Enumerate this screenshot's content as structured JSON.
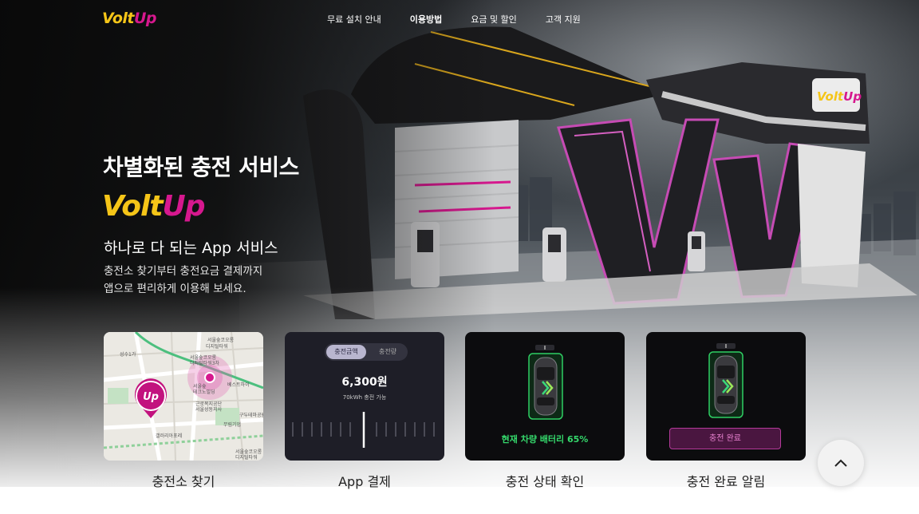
{
  "header": {
    "logo_main": "Volt",
    "logo_accent": "Up",
    "nav": [
      {
        "label": "무료 설치 안내",
        "active": false
      },
      {
        "label": "이용방법",
        "active": true
      },
      {
        "label": "요금 및 할인",
        "active": false
      },
      {
        "label": "고객 지원",
        "active": false
      }
    ]
  },
  "hero": {
    "headline": "차별화된 충전 서비스",
    "brand_main": "Volt",
    "brand_accent": "Up",
    "subtitle": "하나로 다 되는 App 서비스",
    "description_line1": "충전소 찾기부터 충전요금 결제까지",
    "description_line2": "앱으로 편리하게 이용해 보세요.",
    "station_sign": "VoltUp"
  },
  "features": [
    {
      "label": "충전소 찾기"
    },
    {
      "label": "App 결제"
    },
    {
      "label": "충전 상태 확인"
    },
    {
      "label": "충전 완료 알림"
    }
  ],
  "map_card": {
    "pin_logo": "Up",
    "labels": [
      "서울숲코오롱",
      "디지털타워",
      "서울숲코오롱",
      "디지털타워3차",
      "베스트하이",
      "서울숲",
      "테크노빌딩",
      "근로복지공단",
      "서울성동지사",
      "서울숲코오롱",
      "디지털타워",
      "성수1가",
      "갤러리아포레",
      "무림기업",
      "구두테마공원"
    ]
  },
  "payment_card": {
    "toggle_on": "충전금액",
    "toggle_off": "충전량",
    "amount": "6,300원",
    "sub": "70kWh 충전 가능"
  },
  "status_card": {
    "status_text": "현재 차량 배터리  65%",
    "battery_percent": 65
  },
  "done_card": {
    "button_label": "충전 완료"
  },
  "colors": {
    "brand_yellow": "#f5c518",
    "brand_magenta": "#d6188e",
    "status_green": "#35d96c"
  },
  "icons": {
    "scroll_top": "chevron-up-icon"
  }
}
